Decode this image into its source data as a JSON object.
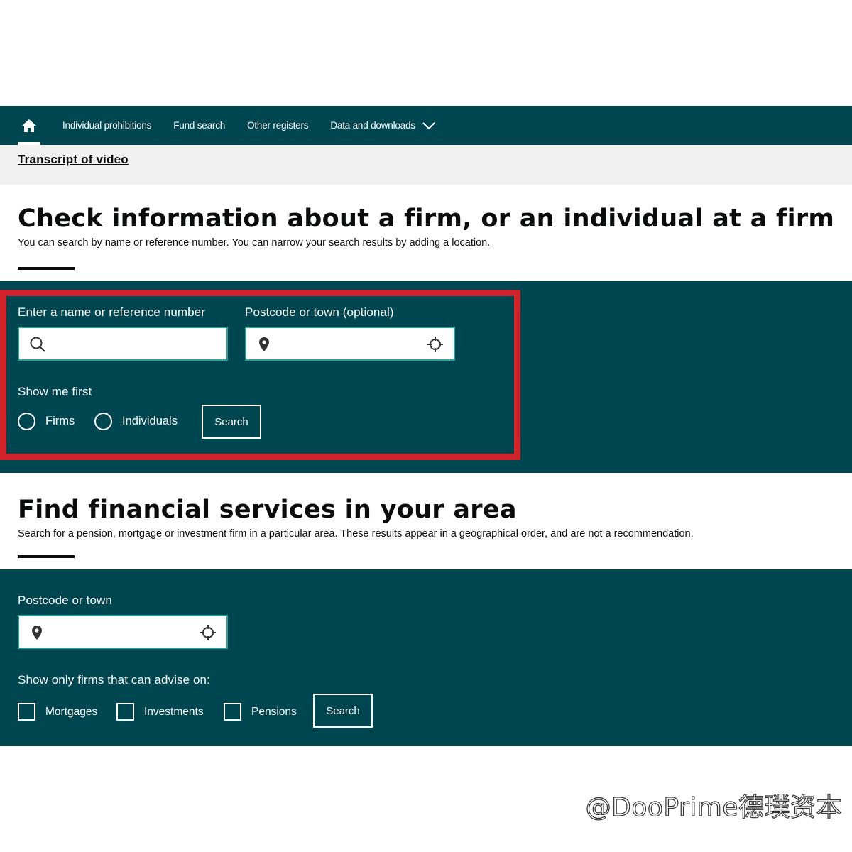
{
  "nav": {
    "items": [
      {
        "label": "Individual prohibitions"
      },
      {
        "label": "Fund search"
      },
      {
        "label": "Other registers"
      },
      {
        "label": "Data and downloads"
      }
    ]
  },
  "strip": {
    "link": "Transcript of video"
  },
  "firm_search": {
    "title": "Check information about a firm, or an individual at a firm",
    "subtitle": "You can search by name or reference number. You can narrow your search results by adding a location.",
    "name_label": "Enter a name or reference number",
    "name_value": "",
    "location_label": "Postcode or town (optional)",
    "location_value": "",
    "show_first_label": "Show me first",
    "options": [
      {
        "label": "Firms",
        "selected": false
      },
      {
        "label": "Individuals",
        "selected": false
      }
    ],
    "search_button": "Search",
    "highlight_color": "#d2232a"
  },
  "area_search": {
    "title": "Find financial services in your area",
    "subtitle": "Search for a pension, mortgage or investment firm in a particular area. These results appear in a geographical order, and are not a recommendation.",
    "location_label": "Postcode or town",
    "location_value": "",
    "filter_label": "Show only firms that can advise on:",
    "options": [
      {
        "label": "Mortgages",
        "checked": false
      },
      {
        "label": "Investments",
        "checked": false
      },
      {
        "label": "Pensions",
        "checked": false
      }
    ],
    "search_button": "Search"
  },
  "colors": {
    "brand_teal": "#004650",
    "field_border": "#28a197",
    "strip_gray": "#f0f0f0"
  },
  "watermark": "@DooPrime德璞资本"
}
